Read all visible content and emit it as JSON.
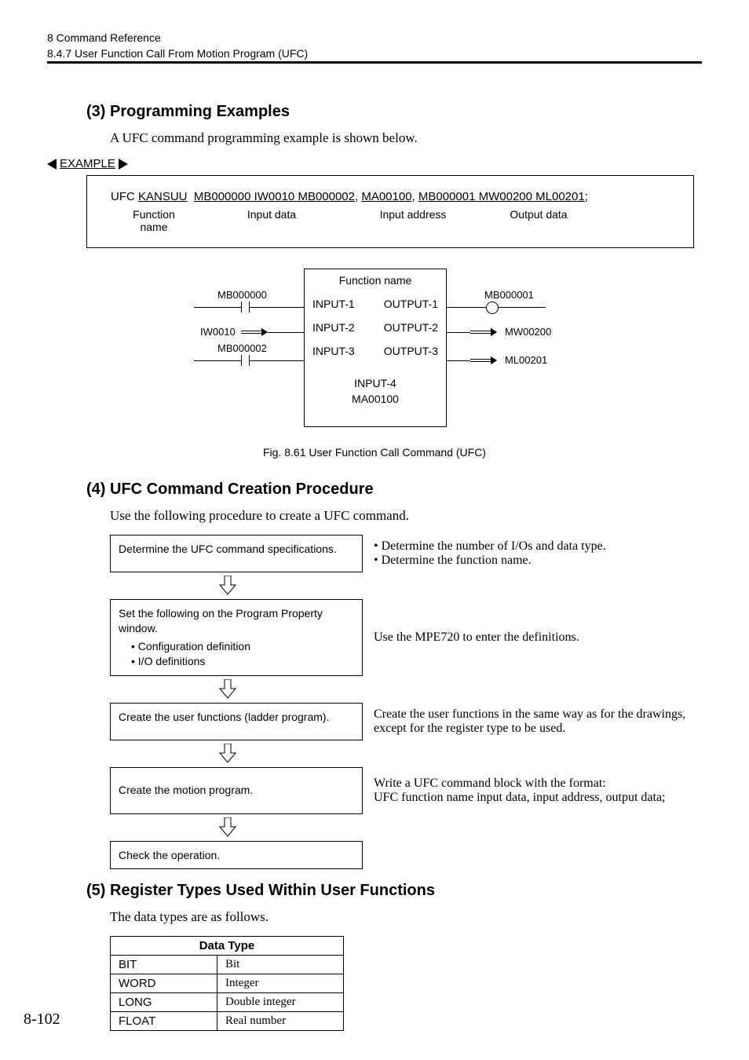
{
  "header": {
    "chapter": "8  Command Reference",
    "section": "8.4.7  User Function Call From Motion Program (UFC)"
  },
  "s3": {
    "heading": "(3) Programming Examples",
    "intro": "A UFC command programming example is shown below.",
    "example_label": "EXAMPLE",
    "code": "UFC KANSUU  MB000000 IW0010 MB000002, MA00100, MB000001 MW00200 ML00201;",
    "u1": "KANSUU",
    "u2": "MB000000 IW0010 MB000002",
    "u3": "MA00100",
    "u4": "MB000001 MW00200 ML00201",
    "labels": {
      "fn": "Function\nname",
      "in": "Input data",
      "addr": "Input address",
      "out": "Output data"
    },
    "diagram": {
      "fn_name": "Function name",
      "in1": "INPUT-1",
      "out1": "OUTPUT-1",
      "in2": "INPUT-2",
      "out2": "OUTPUT-2",
      "in3": "INPUT-3",
      "out3": "OUTPUT-3",
      "in4": "INPUT-4",
      "in4addr": "MA00100",
      "left1": "MB000000",
      "left2": "IW0010",
      "left3": "MB000002",
      "right1": "MB000001",
      "right2": "MW00200",
      "right3": "ML00201"
    },
    "figcap": "Fig. 8.61  User Function Call Command (UFC)"
  },
  "s4": {
    "heading": "(4) UFC Command Creation Procedure",
    "intro": "Use the following procedure to create a UFC command.",
    "steps": [
      {
        "box": "Determine the UFC command specifications.",
        "desc_lines": [
          "• Determine the number of I/Os and data type.",
          "• Determine the function name."
        ]
      },
      {
        "box": "Set the following on the Program Property window.",
        "bullets": [
          "Configuration definition",
          "I/O definitions"
        ],
        "desc": "Use the MPE720 to enter the definitions."
      },
      {
        "box": "Create the user functions (ladder program).",
        "desc": "Create the user functions in the same way as for the drawings, except for the register type to be used."
      },
      {
        "box": "Create the motion program.",
        "desc": "Write a UFC command block with the format:\nUFC function name input data, input address, output data;"
      },
      {
        "box": "Check the operation.",
        "desc": ""
      }
    ]
  },
  "s5": {
    "heading": "(5) Register Types Used Within User Functions",
    "intro": "The data types are as follows.",
    "table": {
      "header": "Data Type",
      "rows": [
        {
          "code": "BIT",
          "desc": "Bit"
        },
        {
          "code": "WORD",
          "desc": "Integer"
        },
        {
          "code": "LONG",
          "desc": "Double integer"
        },
        {
          "code": "FLOAT",
          "desc": "Real number"
        }
      ]
    }
  },
  "page_no": "8-102"
}
